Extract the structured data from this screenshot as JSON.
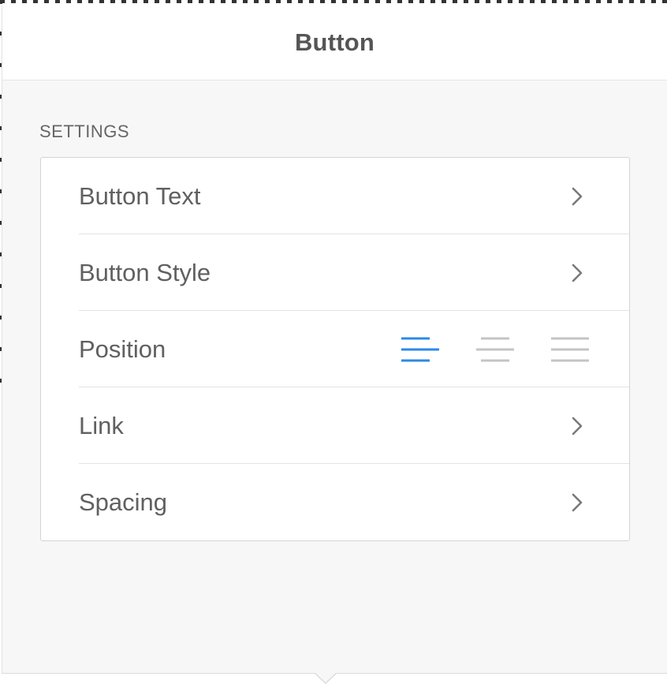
{
  "panel": {
    "title": "Button"
  },
  "settings": {
    "section_label": "SETTINGS",
    "rows": [
      {
        "label": "Button Text",
        "control": "chevron"
      },
      {
        "label": "Button Style",
        "control": "chevron"
      },
      {
        "label": "Position",
        "control": "alignment"
      },
      {
        "label": "Link",
        "control": "chevron"
      },
      {
        "label": "Spacing",
        "control": "chevron"
      }
    ]
  },
  "position": {
    "options": [
      "align-left-icon",
      "align-center-icon",
      "align-right-icon"
    ],
    "selected": "align-left"
  },
  "colors": {
    "accent": "#2b8ae8",
    "inactive_icon": "#c4c4c4",
    "chevron": "#7a7a7a"
  }
}
